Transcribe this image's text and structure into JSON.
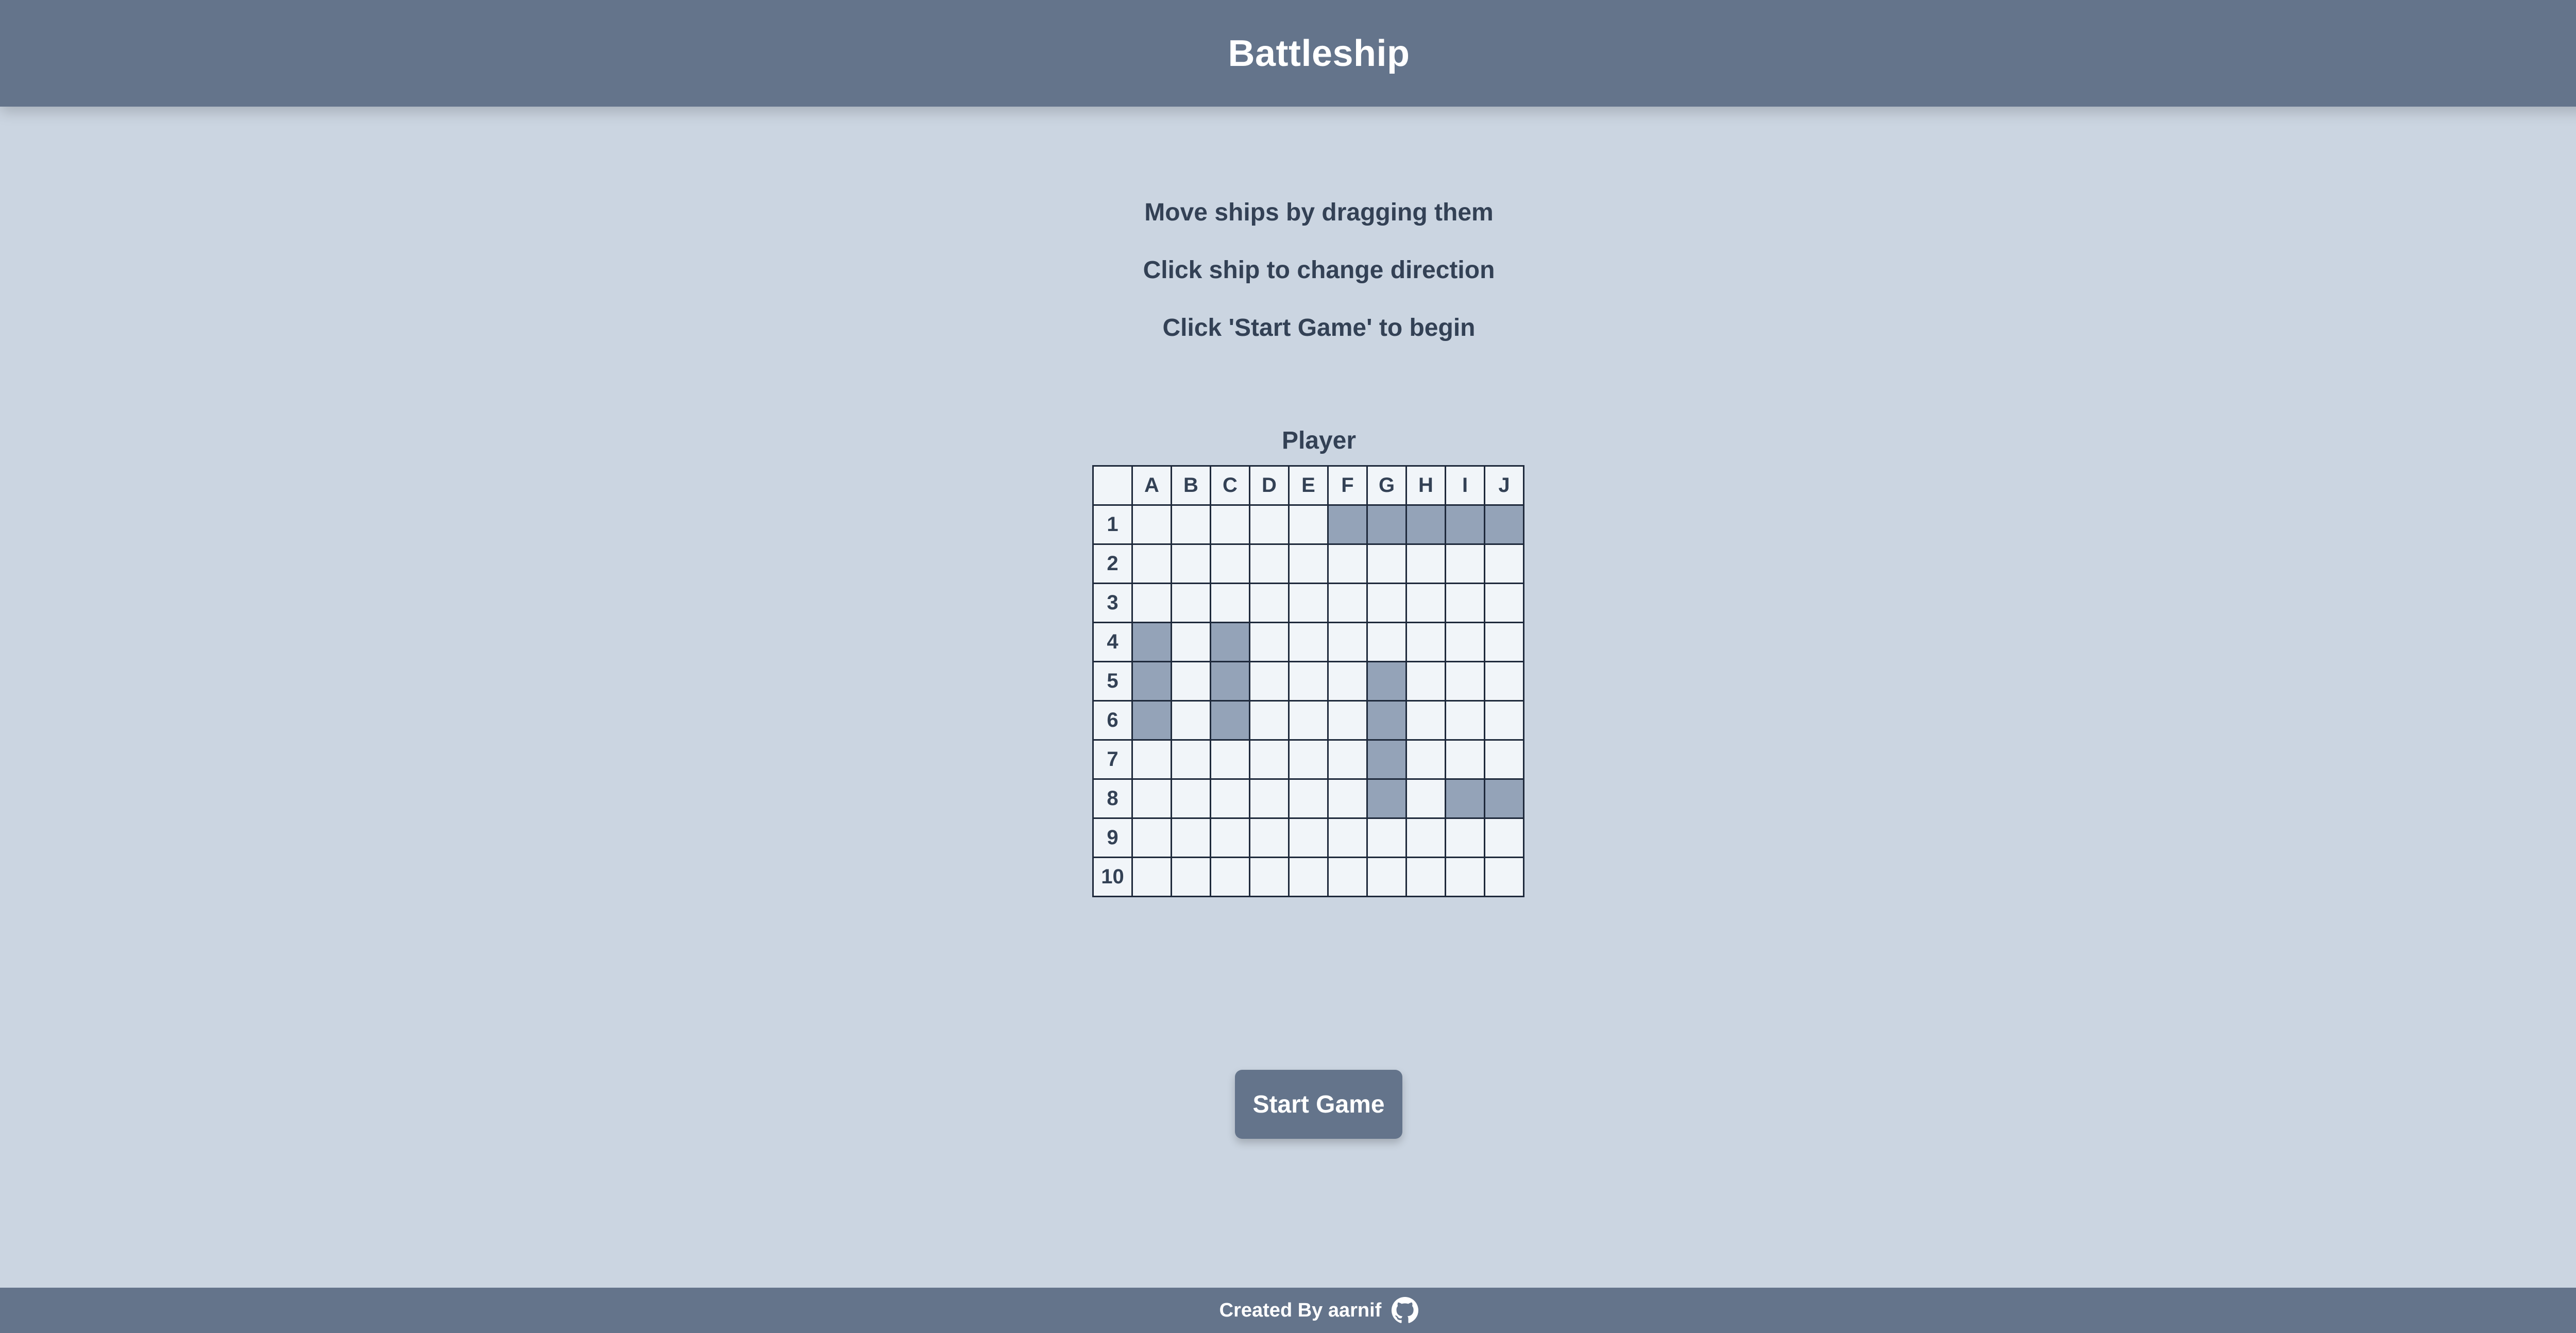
{
  "app": {
    "title": "Battleship"
  },
  "instructions": [
    "Move ships by dragging them",
    "Click ship to change direction",
    "Click 'Start Game' to begin"
  ],
  "board": {
    "title": "Player",
    "columns": [
      "A",
      "B",
      "C",
      "D",
      "E",
      "F",
      "G",
      "H",
      "I",
      "J"
    ],
    "rows": [
      "1",
      "2",
      "3",
      "4",
      "5",
      "6",
      "7",
      "8",
      "9",
      "10"
    ],
    "ship_cells": [
      "F1",
      "G1",
      "H1",
      "I1",
      "J1",
      "A4",
      "A5",
      "A6",
      "C4",
      "C5",
      "C6",
      "G5",
      "G6",
      "G7",
      "G8",
      "I8",
      "J8"
    ]
  },
  "actions": {
    "start_label": "Start Game"
  },
  "footer": {
    "credit": "Created By aarnif",
    "icon": "github-icon"
  },
  "colors": {
    "header_bg": "#64748b",
    "page_bg": "#cbd5e1",
    "cell_bg": "#f1f5f9",
    "ship_bg": "#94a3b8",
    "text": "#334155"
  }
}
